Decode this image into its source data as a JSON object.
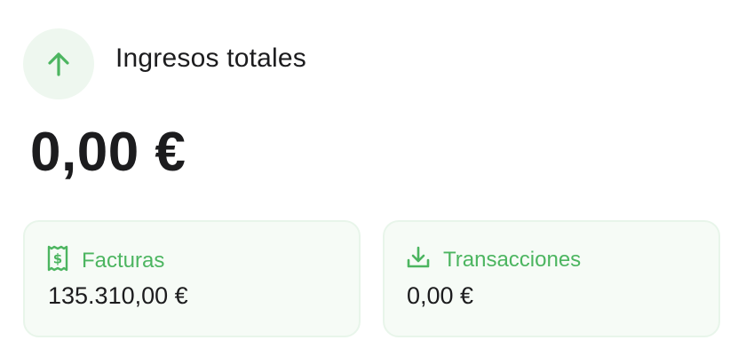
{
  "header": {
    "title": "Ingresos totales",
    "icon": "arrow-up-icon"
  },
  "total_amount": "0,00 €",
  "tiles": [
    {
      "label": "Facturas",
      "value": "135.310,00 €",
      "icon": "invoice-dollar-icon"
    },
    {
      "label": "Transacciones",
      "value": "0,00 €",
      "icon": "download-icon"
    }
  ],
  "colors": {
    "accent": "#4cb560",
    "icon_bg": "#eef7ef",
    "tile_bg": "#f6fbf6",
    "tile_border": "#e8f5ea",
    "text": "#1c1c1e"
  }
}
